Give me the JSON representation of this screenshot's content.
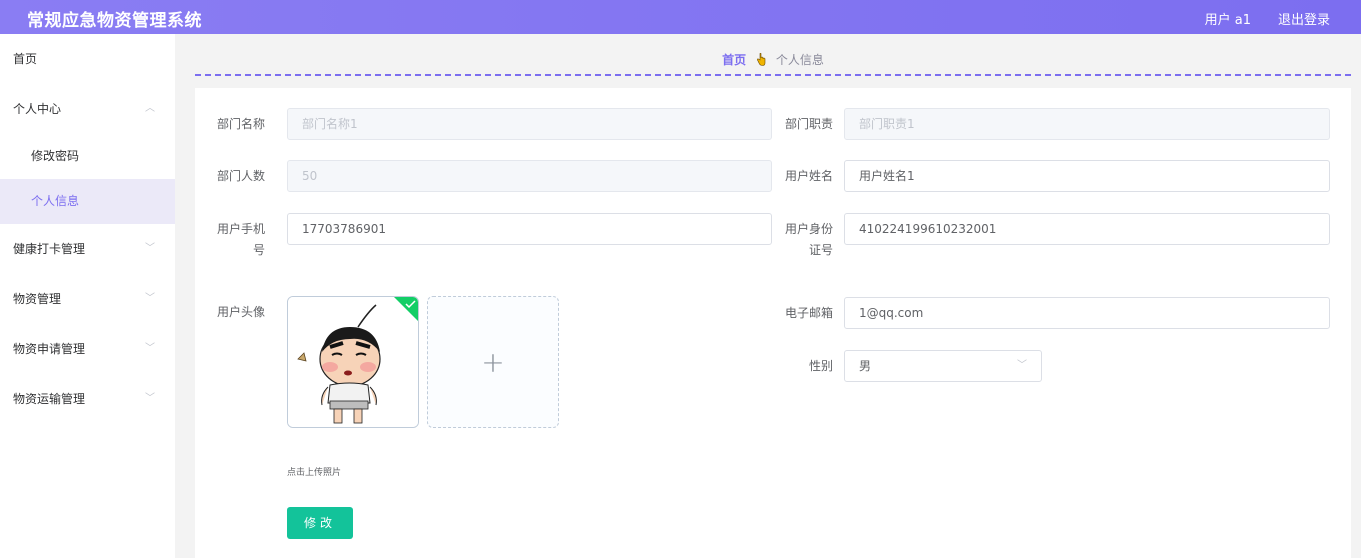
{
  "header": {
    "title": "常规应急物资管理系统",
    "user_label": "用户 a1",
    "logout_label": "退出登录"
  },
  "sidebar": {
    "home": "首页",
    "personal_center": "个人中心",
    "change_password": "修改密码",
    "personal_info": "个人信息",
    "health_checkin": "健康打卡管理",
    "materials": "物资管理",
    "material_apply": "物资申请管理",
    "material_transport": "物资运输管理"
  },
  "breadcrumb": {
    "home": "首页",
    "separator_icon": "hand-pointer-icon",
    "current": "个人信息"
  },
  "form": {
    "dept_name_label": "部门名称",
    "dept_name_value": "部门名称1",
    "dept_duty_label": "部门职责",
    "dept_duty_value": "部门职责1",
    "dept_count_label": "部门人数",
    "dept_count_value": "50",
    "user_name_label": "用户姓名",
    "user_name_value": "用户姓名1",
    "phone_label_1": "用户手机",
    "phone_label_2": "号",
    "phone_value": "17703786901",
    "id_label_1": "用户身份",
    "id_label_2": "证号",
    "id_value": "410224199610232001",
    "avatar_label": "用户头像",
    "email_label": "电子邮箱",
    "email_value": "1@qq.com",
    "gender_label": "性别",
    "gender_value": "男",
    "upload_tip": "点击上传照片",
    "submit_label": "修改"
  },
  "colors": {
    "brand": "#7c6ef0",
    "submit": "#13c39a",
    "upload_success": "#13ce66"
  }
}
